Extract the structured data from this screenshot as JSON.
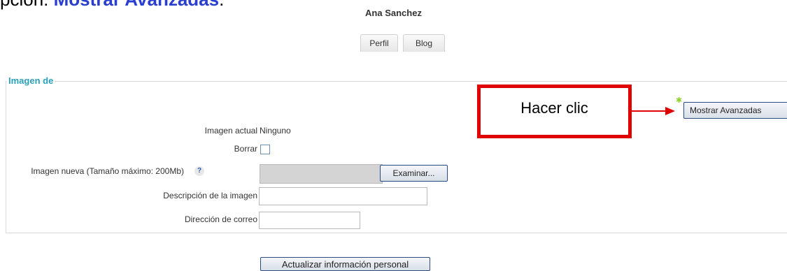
{
  "instruction": {
    "prefix": "pción: ",
    "highlight": "Mostrar Avanzadas",
    "suffix": "."
  },
  "header": {
    "user_name": "Ana Sanchez"
  },
  "tabs": [
    {
      "label": "Perfil"
    },
    {
      "label": "Blog"
    }
  ],
  "section": {
    "legend": "Imagen de"
  },
  "fields": {
    "current_image": {
      "label": "Imagen actual",
      "value": "Ninguno"
    },
    "delete": {
      "label": "Borrar",
      "checked": false
    },
    "new_image": {
      "label": "Imagen nueva (Tamaño máximo: 200Mb)",
      "button": "Examinar..."
    },
    "description": {
      "label": "Descripción de la imagen",
      "value": ""
    },
    "email": {
      "label": "Dirección de correo",
      "value": ""
    }
  },
  "annotation": {
    "text": "Hacer clic"
  },
  "advanced_button": {
    "label": "Mostrar Avanzadas"
  },
  "submit_button": {
    "label": "Actualizar información personal"
  },
  "colors": {
    "accent": "#2aa0b7",
    "annotation_red": "#e00000",
    "instruction_blue": "#2a3fd0",
    "star_green": "#8fd12e"
  }
}
